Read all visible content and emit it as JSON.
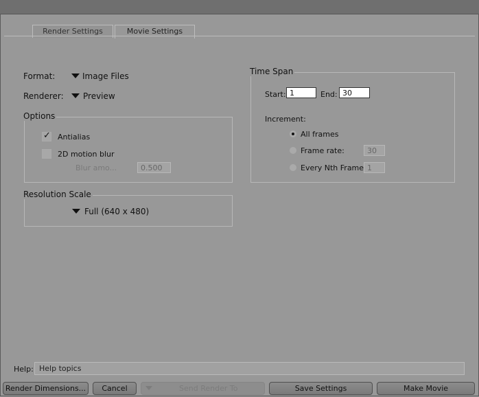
{
  "tabs": [
    {
      "label": "Render Settings"
    },
    {
      "label": "Movie Settings"
    }
  ],
  "format": {
    "label": "Format:",
    "value": "Image Files"
  },
  "renderer": {
    "label": "Renderer:",
    "value": "Preview"
  },
  "options": {
    "title": "Options",
    "antialias": {
      "label": "Antialias",
      "checked": true
    },
    "motion_blur": {
      "label": "2D motion blur",
      "checked": false
    },
    "blur_amount": {
      "label": "Blur amo...",
      "value": "0.500"
    }
  },
  "resolution": {
    "title": "Resolution Scale",
    "value": "Full (640 x 480)"
  },
  "time_span": {
    "title": "Time Span",
    "start_label": "Start:",
    "start_value": "1",
    "end_label": "End:",
    "end_value": "30",
    "increment_label": "Increment:",
    "all_frames": {
      "label": "All frames",
      "selected": true
    },
    "frame_rate": {
      "label": "Frame rate:",
      "value": "30",
      "selected": false
    },
    "every_nth": {
      "label": "Every Nth Frame:",
      "value": "1",
      "selected": false
    }
  },
  "help": {
    "label": "Help:",
    "value": "Help topics"
  },
  "buttons": {
    "render_dimensions": "Render Dimensions...",
    "cancel": "Cancel",
    "send_render_to": "Send Render To",
    "save_settings": "Save Settings",
    "make_movie": "Make Movie"
  }
}
